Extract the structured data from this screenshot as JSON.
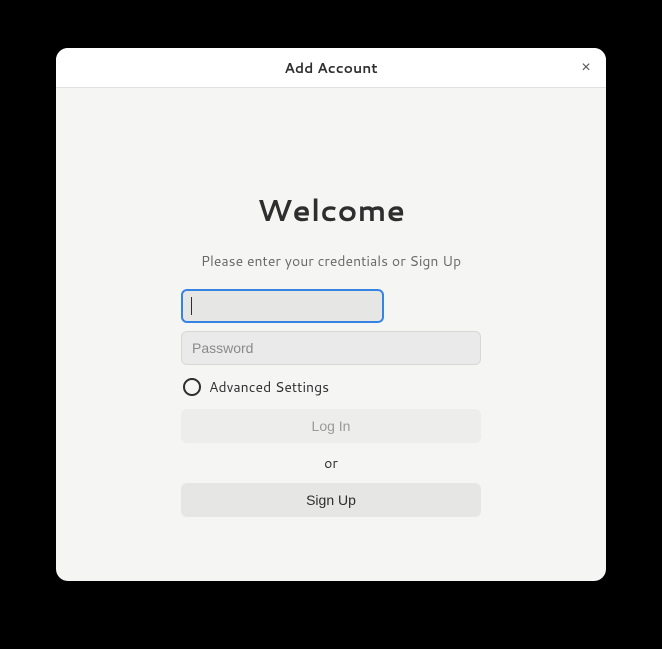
{
  "header": {
    "title": "Add Account"
  },
  "content": {
    "welcome": "Welcome",
    "subtitle": "Please enter your credentials or Sign Up"
  },
  "form": {
    "username_value": "",
    "username_placeholder": "",
    "password_value": "",
    "password_placeholder": "Password",
    "advanced_label": "Advanced Settings",
    "login_label": "Log In",
    "or_label": "or",
    "signup_label": "Sign Up"
  }
}
